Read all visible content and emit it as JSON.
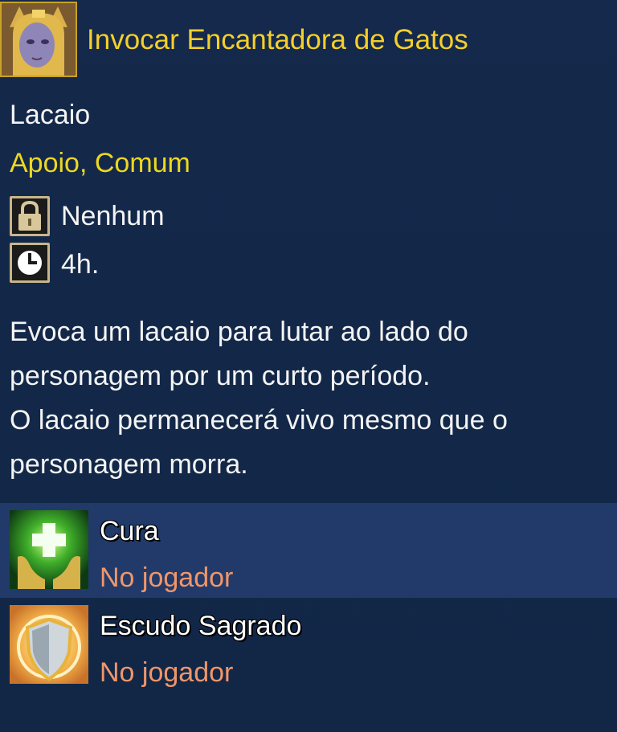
{
  "skill": {
    "title": "Invocar Encantadora de Gatos",
    "type": "Lacaio",
    "tags": "Apoio, Comum",
    "requirement": {
      "icon": "lock-icon",
      "value": "Nenhum"
    },
    "cooldown": {
      "icon": "clock-icon",
      "value": "4h."
    },
    "description": [
      "Evoca um lacaio para lutar ao lado do",
      "personagem por um curto período.",
      "O lacaio permanecerá vivo mesmo que o",
      "personagem morra."
    ]
  },
  "effects": [
    {
      "icon": "heal-hands-icon",
      "name": "Cura",
      "target": "No jogador"
    },
    {
      "icon": "holy-shield-icon",
      "name": "Escudo Sagrado",
      "target": "No jogador"
    }
  ],
  "colors": {
    "background": "#13294a",
    "title": "#f5cf2a",
    "tags": "#ecd820",
    "target": "#f0966a",
    "highlight_row": "#223a69"
  }
}
